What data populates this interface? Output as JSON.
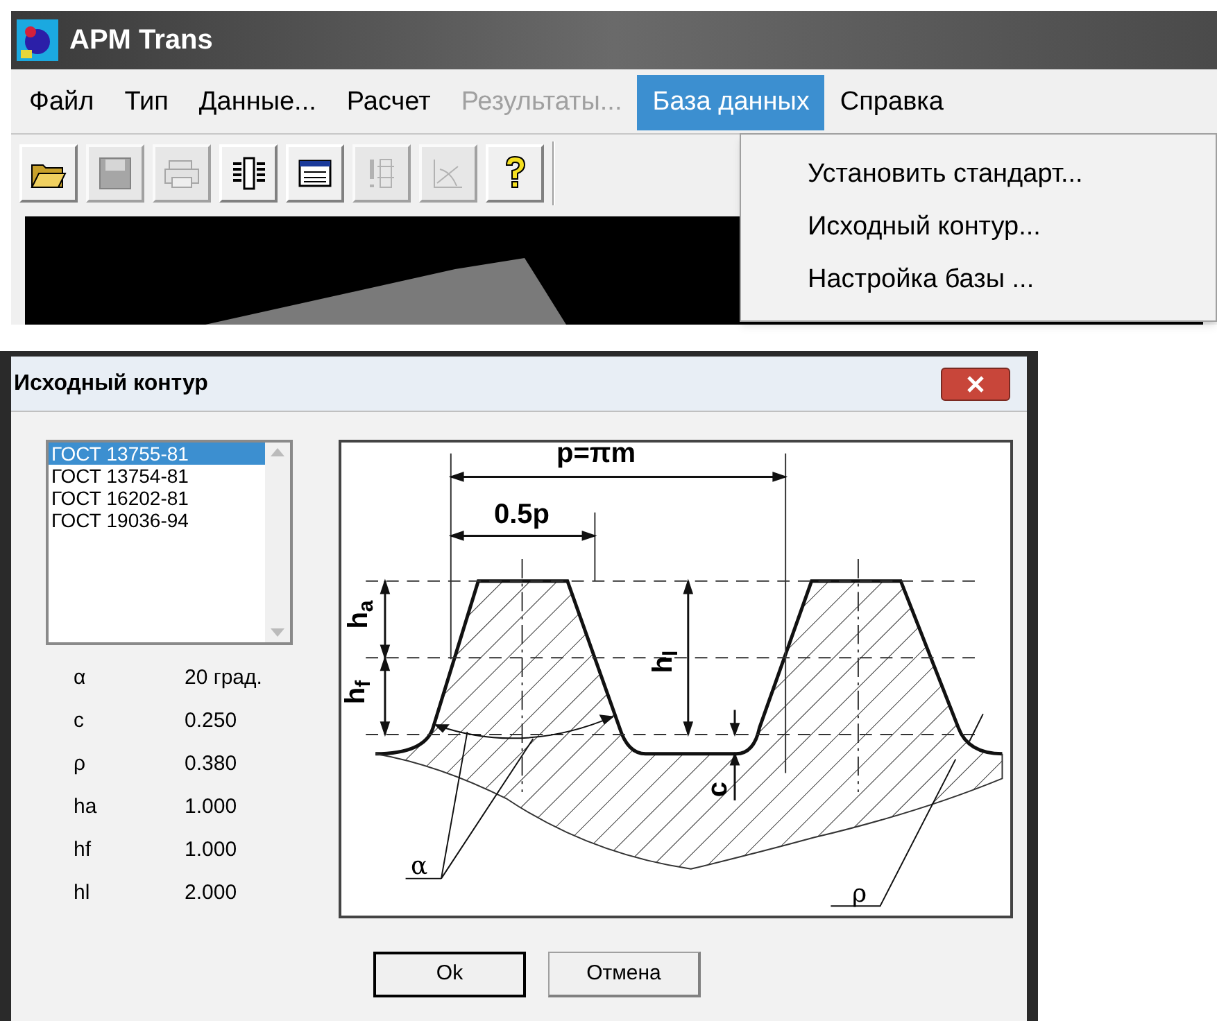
{
  "app_window": {
    "title": "APM Trans",
    "menu": [
      {
        "label": "Файл",
        "disabled": false,
        "selected": false
      },
      {
        "label": "Тип",
        "disabled": false,
        "selected": false
      },
      {
        "label": "Данные...",
        "disabled": false,
        "selected": false
      },
      {
        "label": "Расчет",
        "disabled": false,
        "selected": false
      },
      {
        "label": "Результаты...",
        "disabled": true,
        "selected": false
      },
      {
        "label": "База данных",
        "disabled": false,
        "selected": true
      },
      {
        "label": "Справка",
        "disabled": false,
        "selected": false
      }
    ],
    "toolbar": [
      {
        "kind": "open",
        "disabled": false
      },
      {
        "kind": "save",
        "disabled": true
      },
      {
        "kind": "print",
        "disabled": true
      },
      {
        "kind": "structure",
        "disabled": false
      },
      {
        "kind": "table",
        "disabled": false
      },
      {
        "kind": "shaft",
        "disabled": true
      },
      {
        "kind": "plot",
        "disabled": true
      },
      {
        "kind": "help",
        "disabled": false
      }
    ],
    "dropdown": [
      "Установить стандарт...",
      "Исходный контур...",
      "Настройка базы ..."
    ]
  },
  "dialog": {
    "title": "Исходный контур",
    "standards": [
      {
        "label": "ГОСТ 13755-81",
        "selected": true
      },
      {
        "label": "ГОСТ 13754-81",
        "selected": false
      },
      {
        "label": "ГОСТ 16202-81",
        "selected": false
      },
      {
        "label": "ГОСТ 19036-94",
        "selected": false
      }
    ],
    "parameters": [
      {
        "symbol": "α",
        "value": "20 град."
      },
      {
        "symbol": "c",
        "value": "0.250"
      },
      {
        "symbol": "ρ",
        "value": "0.380"
      },
      {
        "symbol": "ha",
        "value": "1.000"
      },
      {
        "symbol": "hf",
        "value": "1.000"
      },
      {
        "symbol": "hl",
        "value": "2.000"
      }
    ],
    "diagram_labels": {
      "pitch": "p=πm",
      "half_pitch": "0.5p",
      "addendum": "h$_{a}$",
      "dedendum": "h$_{f}$",
      "working_depth": "h$_{l}$",
      "clearance": "c",
      "angle": "α",
      "radius": "ρ"
    },
    "buttons": [
      {
        "label": "Ok",
        "default": true
      },
      {
        "label": "Отмена",
        "default": false
      }
    ]
  }
}
